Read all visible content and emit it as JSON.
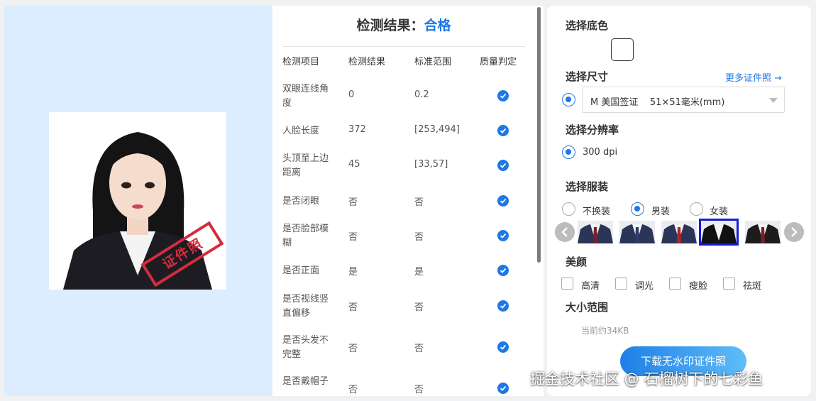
{
  "preview": {
    "stamp_text": "证件照",
    "photo_bg": "#ffffff",
    "panel_bg": "#dcedff"
  },
  "results": {
    "title_prefix": "检测结果：",
    "title_status": "合格",
    "headers": [
      "检测项目",
      "检测结果",
      "标准范围",
      "质量判定"
    ],
    "rows": [
      {
        "item": "双眼连线角度",
        "result": "0",
        "range": "0.2",
        "pass": true
      },
      {
        "item": "人脸长度",
        "result": "372",
        "range": "[253,494]",
        "pass": true
      },
      {
        "item": "头顶至上边距离",
        "result": "45",
        "range": "[33,57]",
        "pass": true
      },
      {
        "item": "是否闭眼",
        "result": "否",
        "range": "否",
        "pass": true
      },
      {
        "item": "是否脸部模糊",
        "result": "否",
        "range": "否",
        "pass": true
      },
      {
        "item": "是否正面",
        "result": "是",
        "range": "是",
        "pass": true
      },
      {
        "item": "是否视线竖直偏移",
        "result": "否",
        "range": "否",
        "pass": true
      },
      {
        "item": "是否头发不完整",
        "result": "否",
        "range": "否",
        "pass": true
      },
      {
        "item": "是否戴帽子",
        "result": "否",
        "range": "否",
        "pass": true
      }
    ]
  },
  "settings": {
    "bg_color_label": "选择底色",
    "bg_color_value": "#ffffff",
    "size_label": "选择尺寸",
    "more_link": "更多证件照",
    "size_value": "M 美国签证    51×51毫米(mm)",
    "dpi_label": "选择分辨率",
    "dpi_value": "300 dpi",
    "clothing_label": "选择服装",
    "clothing_options": [
      "不换装",
      "男装",
      "女装"
    ],
    "clothing_selected": "男装",
    "beauty_label": "美颜",
    "beauty_options": [
      "高清",
      "调光",
      "瘦脸",
      "祛斑"
    ],
    "size_range_label": "大小范围",
    "size_current": "当前约34KB",
    "download_button": "下载无水印证件照"
  },
  "watermark": "掘金技术社区 @ 石榴树下的七彩鱼",
  "colors": {
    "accent": "#1e78e6",
    "selected_suit_border": "#1a1ad6"
  }
}
